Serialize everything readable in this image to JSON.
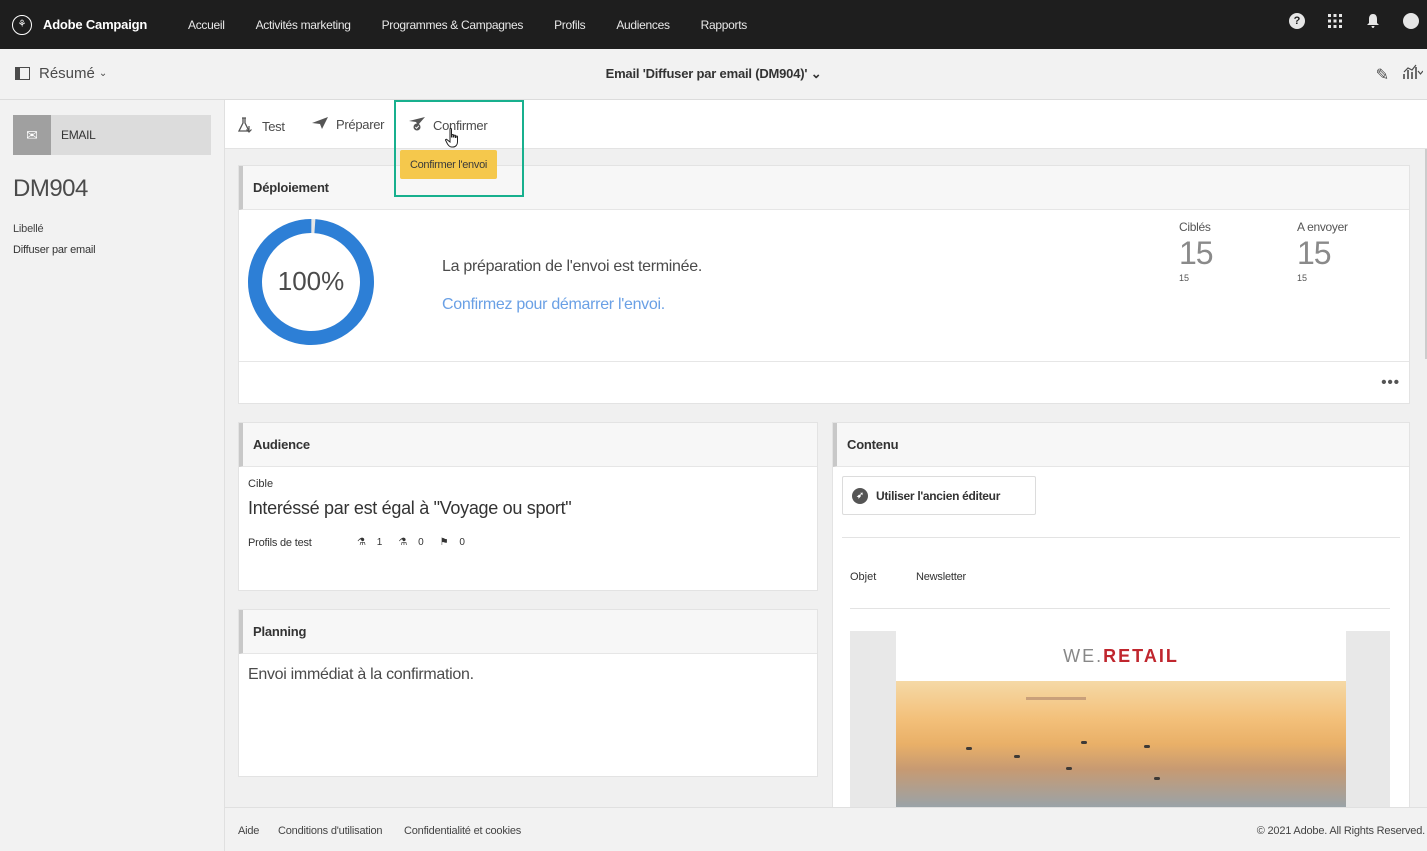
{
  "topbar": {
    "brand": "Adobe Campaign",
    "nav": [
      "Accueil",
      "Activités marketing",
      "Programmes & Campagnes",
      "Profils",
      "Audiences",
      "Rapports"
    ]
  },
  "subbar": {
    "view_label": "Résumé",
    "title": "Email 'Diffuser par email (DM904)'"
  },
  "left": {
    "type": "EMAIL",
    "code": "DM904",
    "label_name": "Libellé",
    "label_value": "Diffuser par email"
  },
  "actions": {
    "test": "Test",
    "prepare": "Préparer",
    "confirm": "Confirmer",
    "tooltip": "Confirmer l'envoi"
  },
  "deployment": {
    "title": "Déploiement",
    "percent": "100%",
    "progress": 1.0,
    "message": "La préparation de l'envoi est terminée.",
    "link": "Confirmez pour démarrer l'envoi.",
    "targeted_label": "Ciblés",
    "targeted_value": "15",
    "targeted_sub": "15",
    "tosend_label": "A envoyer",
    "tosend_value": "15",
    "tosend_sub": "15",
    "more": "•••"
  },
  "audience": {
    "title": "Audience",
    "target_label": "Cible",
    "rule": "Interéssé par est égal à \"Voyage ou sport\"",
    "test_profiles_label": "Profils de test",
    "counts": [
      "1",
      "0",
      "0"
    ]
  },
  "planning": {
    "title": "Planning",
    "text": "Envoi immédiat à la confirmation."
  },
  "content": {
    "title": "Contenu",
    "old_editor": "Utiliser l'ancien éditeur",
    "subject_label": "Objet",
    "subject_value": "Newsletter",
    "brand_we": "WE.",
    "brand_retail": "RETAIL"
  },
  "footer": {
    "help": "Aide",
    "terms": "Conditions d'utilisation",
    "privacy": "Confidentialité et cookies",
    "copyright": "© 2021 Adobe. All Rights Reserved."
  },
  "colors": {
    "accent_blue": "#2d7fd6",
    "link_blue": "#6aa0e5",
    "highlight_green": "#18b08e",
    "tooltip_yellow": "#f5c84c",
    "retail_red": "#c0262e"
  }
}
